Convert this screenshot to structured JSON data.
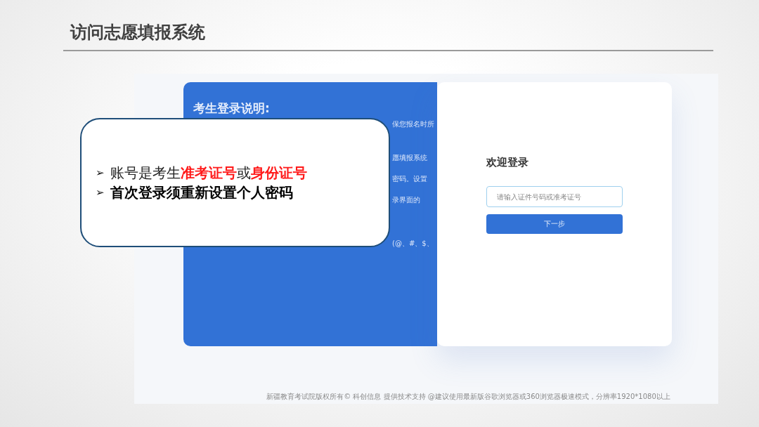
{
  "slide_title": "访问志愿填报系统",
  "login_page": {
    "info_panel": {
      "heading": "考生登录说明:",
      "fragments": [
        "保您报名时所",
        "愿填报系统",
        "密码。设置",
        "录界面的",
        "(@、#、$、"
      ]
    },
    "login_card": {
      "title": "欢迎登录",
      "id_field": {
        "placeholder": "请输入证件号码或准考证号"
      },
      "next_button": "下一步"
    },
    "footer": "新疆教育考试院版权所有© 科创信息 提供技术支持 @建议使用最新版谷歌浏览器或360浏览器极速模式，分辨率1920*1080以上"
  },
  "callout": {
    "items": [
      {
        "kind": "highlight",
        "bullet": "➢",
        "text": "账号是考生**准考证号**或**身份证号**"
      },
      {
        "kind": "note",
        "bullet": "➢",
        "text": "**首次登录须重新设置个人密码**"
      }
    ]
  }
}
